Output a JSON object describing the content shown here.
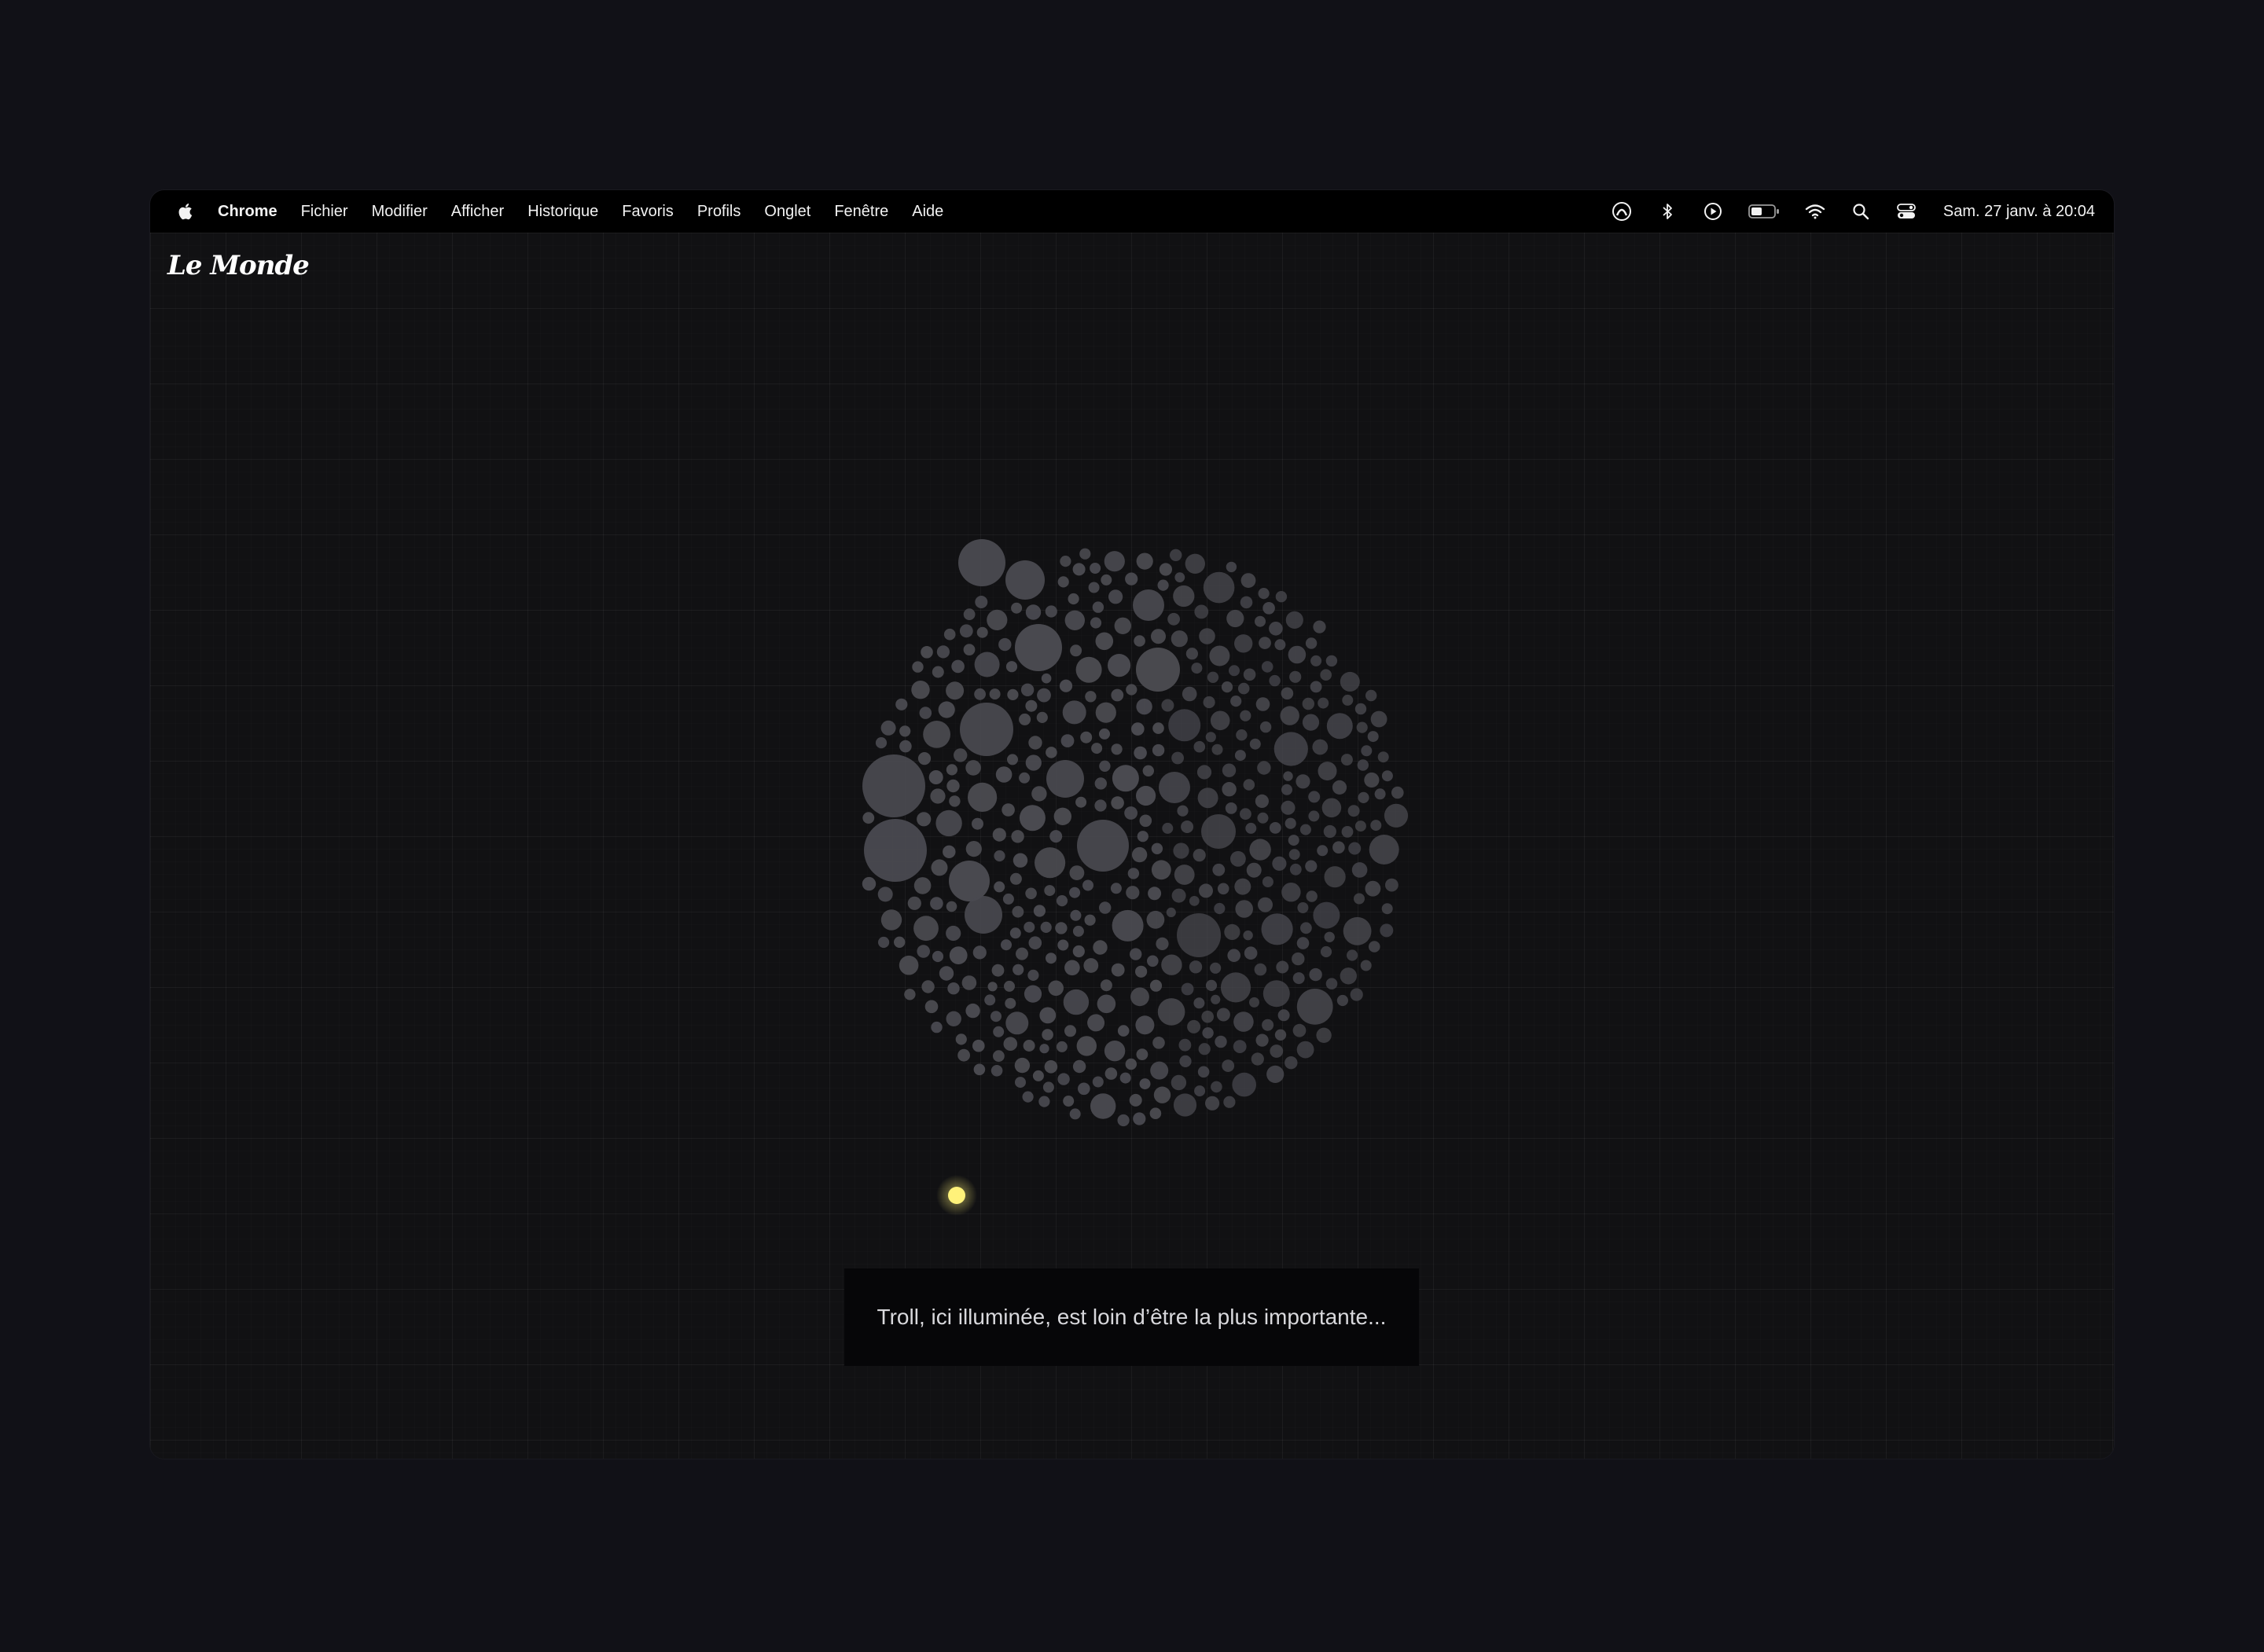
{
  "menubar": {
    "app_name": "Chrome",
    "items": [
      "Fichier",
      "Modifier",
      "Afficher",
      "Historique",
      "Favoris",
      "Profils",
      "Onglet",
      "Fenêtre",
      "Aide"
    ],
    "status_icons": [
      "screen-record-icon",
      "bluetooth-icon",
      "play-icon",
      "battery-icon",
      "wifi-icon",
      "search-icon",
      "control-center-icon"
    ],
    "clock": "Sam. 27 janv. à  20:04"
  },
  "page": {
    "logo_text": "Le Monde",
    "caption": "Troll, ici illuminée, est loin d’être la plus importante...",
    "highlight_color": "#fff27a",
    "bubble_color": "#4a4a50"
  }
}
